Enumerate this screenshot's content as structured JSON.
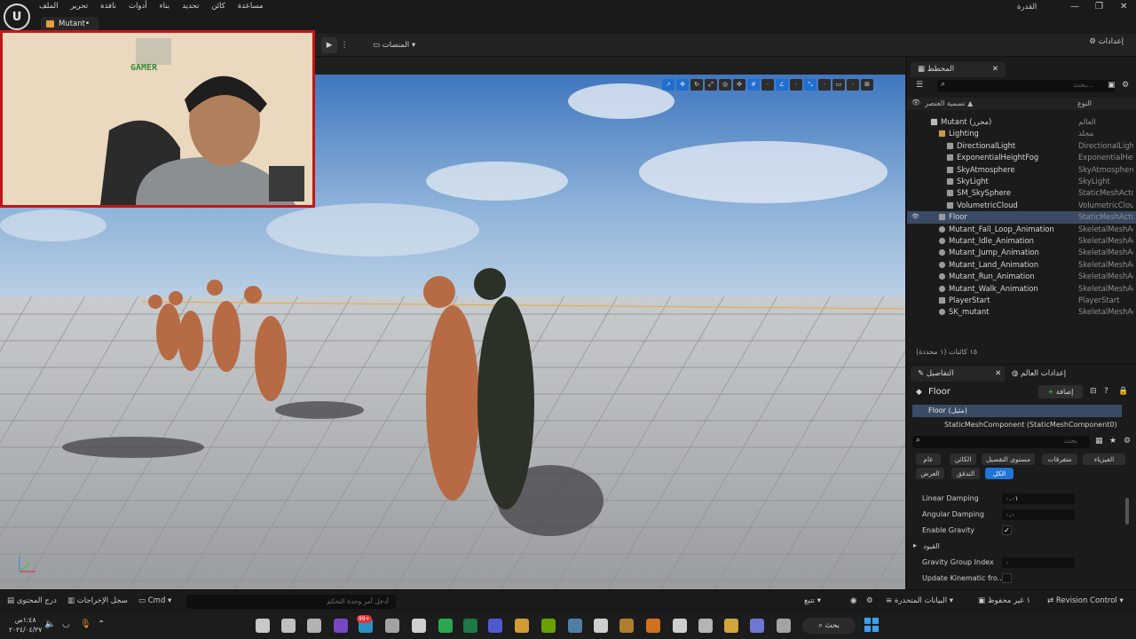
{
  "window": {
    "title": "القدرة",
    "menu": [
      "الملف",
      "تحرير",
      "نافذة",
      "أدوات",
      "بناء",
      "تحديد",
      "كائن",
      "مساعدة"
    ],
    "tab": "Mutant•"
  },
  "toolbar": {
    "platforms": "المنصات",
    "settings": "إعدادات"
  },
  "webcam": {
    "logo_text": "GAMER"
  },
  "outliner": {
    "tab": "المخطط",
    "search_placeholder": "بحث...",
    "col_label": "تسمية العنصر ▲",
    "col_type": "النوع",
    "rows": [
      {
        "label": "Mutant (محرر)",
        "type": "العالم",
        "indent": 0,
        "icon": "world-icon"
      },
      {
        "label": "Lighting",
        "type": "مجلد",
        "indent": 1,
        "icon": "folder-icon"
      },
      {
        "label": "DirectionalLight",
        "type": "DirectionalLight",
        "indent": 2,
        "icon": "light-icon"
      },
      {
        "label": "ExponentialHeightFog",
        "type": "ExponentialHeigh",
        "indent": 2,
        "icon": "fog-icon"
      },
      {
        "label": "SkyAtmosphere",
        "type": "SkyAtmosphere",
        "indent": 2,
        "icon": "sky-icon"
      },
      {
        "label": "SkyLight",
        "type": "SkyLight",
        "indent": 2,
        "icon": "light-icon"
      },
      {
        "label": "SM_SkySphere",
        "type": "StaticMeshActor",
        "indent": 2,
        "icon": "mesh-icon"
      },
      {
        "label": "VolumetricCloud",
        "type": "VolumetricCloud",
        "indent": 2,
        "icon": "cloud-icon"
      },
      {
        "label": "Floor",
        "type": "StaticMeshActor",
        "indent": 1,
        "icon": "mesh-icon",
        "selected": true
      },
      {
        "label": "Mutant_Fall_Loop_Animation",
        "type": "SkeletalMeshAc",
        "indent": 1,
        "icon": "skeletal-icon"
      },
      {
        "label": "Mutant_Idle_Animation",
        "type": "SkeletalMeshAc",
        "indent": 1,
        "icon": "skeletal-icon"
      },
      {
        "label": "Mutant_Jump_Animation",
        "type": "SkeletalMeshAc",
        "indent": 1,
        "icon": "skeletal-icon"
      },
      {
        "label": "Mutant_Land_Animation",
        "type": "SkeletalMeshAc",
        "indent": 1,
        "icon": "skeletal-icon"
      },
      {
        "label": "Mutant_Run_Animation",
        "type": "SkeletalMeshAc",
        "indent": 1,
        "icon": "skeletal-icon"
      },
      {
        "label": "Mutant_Walk_Animation",
        "type": "SkeletalMeshAc",
        "indent": 1,
        "icon": "skeletal-icon"
      },
      {
        "label": "PlayerStart",
        "type": "PlayerStart",
        "indent": 1,
        "icon": "playerstart-icon"
      },
      {
        "label": "SK_mutant",
        "type": "SkeletalMeshAc",
        "indent": 1,
        "icon": "skeletal-icon"
      }
    ],
    "footer": "١٥ كائنات (١ محددة)"
  },
  "details": {
    "tab": "التفاصيل",
    "world_settings_tab": "إعدادات العالم",
    "object_name": "Floor",
    "add_button": "إضافة",
    "root_component": "Floor (مثيل)",
    "sub_component": "StaticMeshComponent (StaticMeshComponent0)",
    "search_placeholder": "بحث",
    "filters_row1": [
      "الفيزياء",
      "متفرقات",
      "مستوى التفصيل",
      "الكائن",
      "عام"
    ],
    "filters_row2": [
      "الكل",
      "التدفق",
      "العرض"
    ],
    "active_filter": "الكل",
    "props": [
      {
        "name": "Linear Damping",
        "value": "٠.٠١",
        "kind": "field"
      },
      {
        "name": "Angular Damping",
        "value": "٠.٠",
        "kind": "field"
      },
      {
        "name": "Enable Gravity",
        "value": "✓",
        "kind": "check"
      },
      {
        "name": "القيود",
        "value": "",
        "kind": "section"
      },
      {
        "name": "Gravity Group Index",
        "value": "٠",
        "kind": "field"
      },
      {
        "name": "Update Kinematic fro...",
        "value": "",
        "kind": "check"
      }
    ]
  },
  "bottombar": {
    "content_drawer": "درج المحتوى",
    "output_log": "سجل الإخراجات",
    "cmd": "Cmd",
    "cmd_placeholder": "أدخل أمر وحدة التحكم",
    "trace": "تتبع",
    "derived_data": "البيانات المتحدرة",
    "unsaved": "١ غير محفوظ",
    "revision_control": "Revision Control"
  },
  "taskbar": {
    "search": "بحث",
    "time": "١:٤٨ص",
    "date": "٢٠٢٤/٠٤/٢٧",
    "badge": "99+"
  },
  "colors": {
    "accent": "#1f74d6",
    "selection": "#3a4b66",
    "webcam_border": "#c41515"
  }
}
